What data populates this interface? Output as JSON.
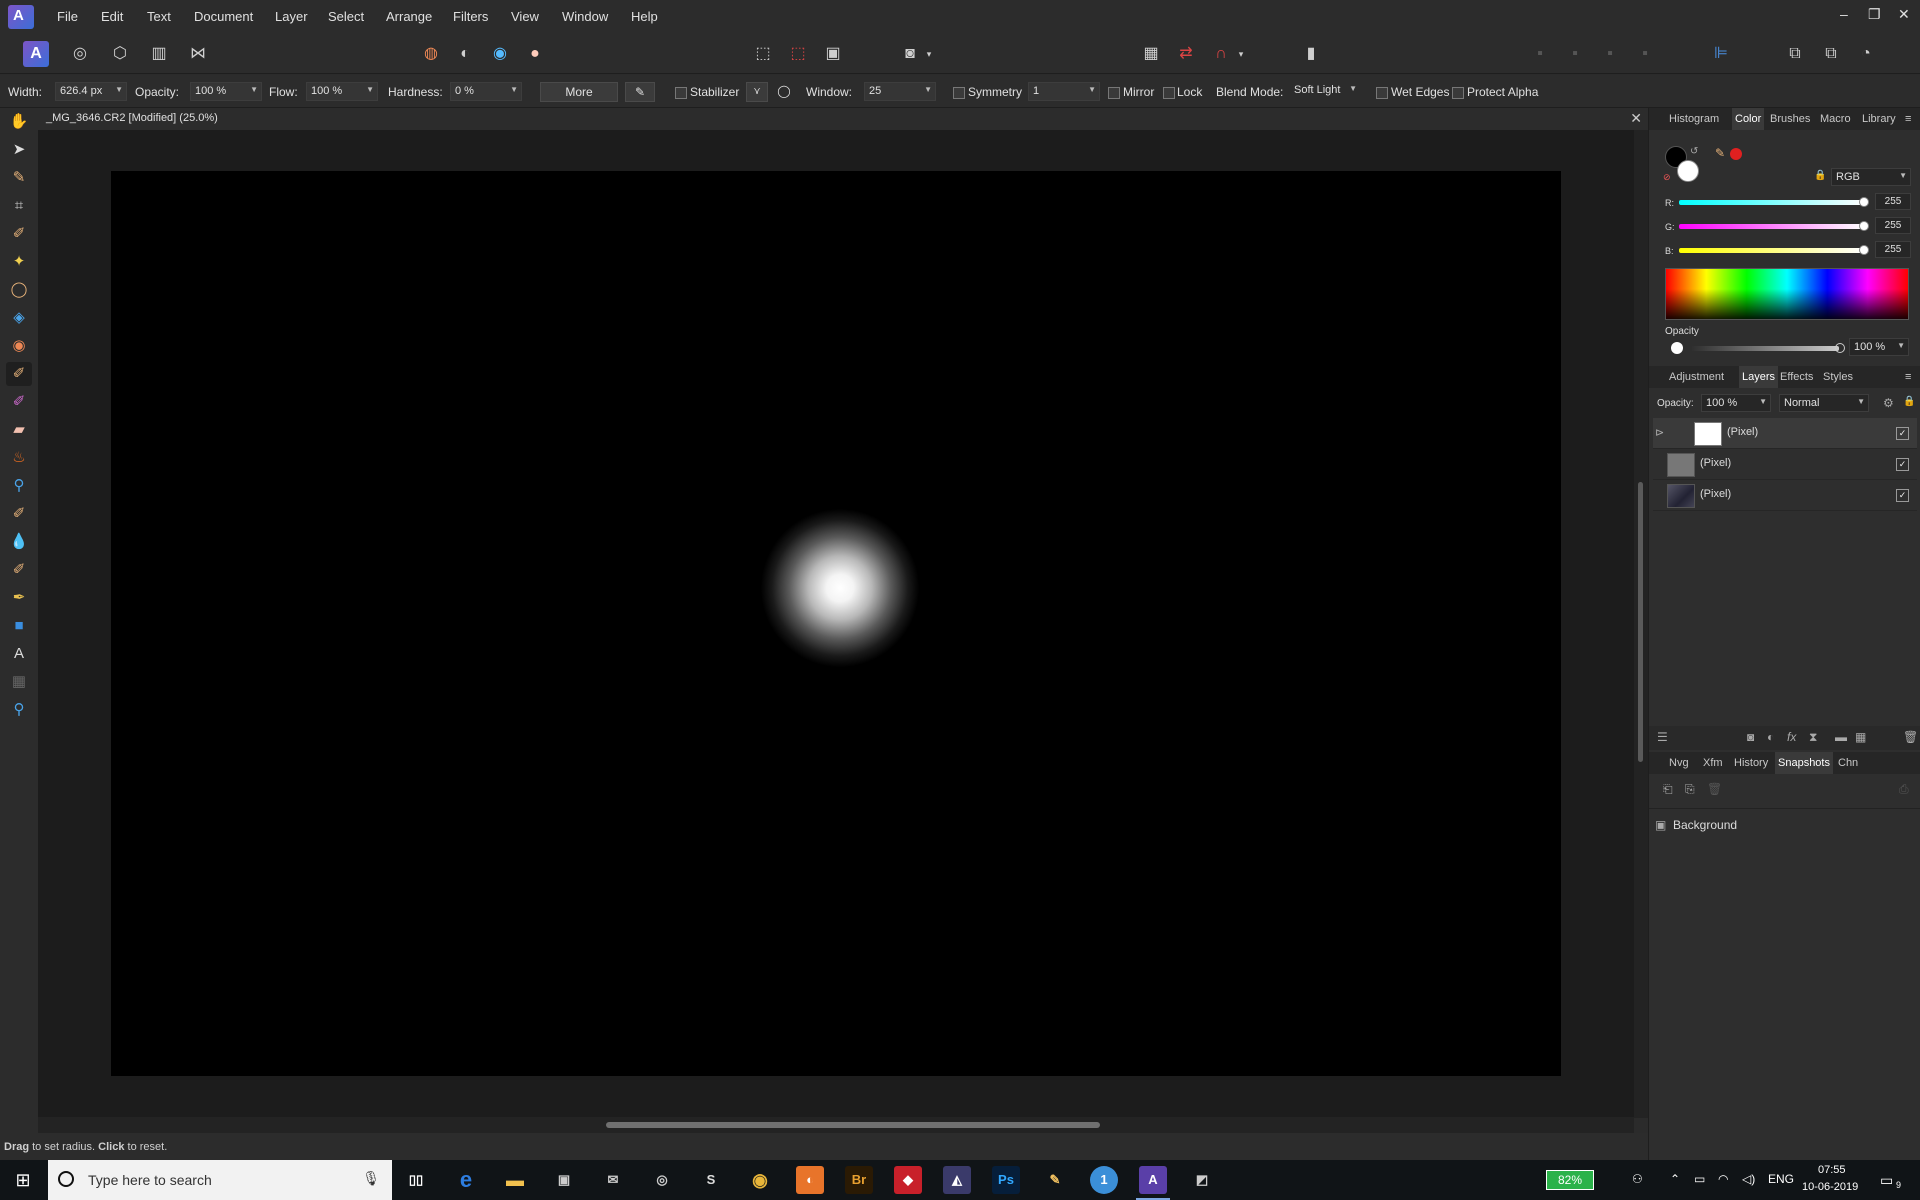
{
  "menubar": {
    "items": [
      "File",
      "Edit",
      "Text",
      "Document",
      "Layer",
      "Select",
      "Arrange",
      "Filters",
      "View",
      "Window",
      "Help"
    ],
    "window_controls": [
      "–",
      "❐",
      "✕"
    ]
  },
  "context": {
    "width_label": "Width:",
    "width_value": "626.4 px",
    "opacity_label": "Opacity:",
    "opacity_value": "100 %",
    "flow_label": "Flow:",
    "flow_value": "100 %",
    "hardness_label": "Hardness:",
    "hardness_value": "0 %",
    "more_label": "More",
    "stabilizer_label": "Stabilizer",
    "window_label": "Window:",
    "window_value": "25",
    "symmetry_label": "Symmetry",
    "symmetry_value": "1",
    "mirror_label": "Mirror",
    "lock_label": "Lock",
    "blend_label": "Blend Mode:",
    "blend_value": "Soft Light",
    "wet_edges_label": "Wet Edges",
    "protect_alpha_label": "Protect Alpha"
  },
  "document": {
    "title": "_MG_3646.CR2 [Modified] (25.0%)"
  },
  "status": {
    "drag": "Drag",
    "drag_text": " to set radius. ",
    "click": "Click",
    "click_text": " to reset."
  },
  "color_panel": {
    "tabs": [
      "Histogram",
      "Color",
      "Brushes",
      "Macro",
      "Library"
    ],
    "selected_tab": "Color",
    "mode": "RGB",
    "r_label": "R:",
    "r_value": "255",
    "g_label": "G:",
    "g_value": "255",
    "b_label": "B:",
    "b_value": "255",
    "opacity_label": "Opacity",
    "opacity_value": "100 %"
  },
  "layers_panel": {
    "tabs": [
      "Adjustment",
      "Layers",
      "Effects",
      "Styles"
    ],
    "selected_tab": "Layers",
    "opacity_label": "Opacity:",
    "opacity_value": "100 %",
    "blend_value": "Normal",
    "layers": [
      {
        "name": "(Pixel)",
        "checked": "✓"
      },
      {
        "name": "(Pixel)",
        "checked": "✓"
      },
      {
        "name": "(Pixel)",
        "checked": "✓"
      }
    ]
  },
  "history_panel": {
    "tabs": [
      "Nvg",
      "Xfm",
      "History",
      "Snapshots",
      "Chn"
    ],
    "selected_tab": "Snapshots",
    "snapshots": [
      "Background"
    ]
  },
  "taskbar": {
    "search_placeholder": "Type here to search",
    "battery": "82%",
    "language": "ENG",
    "time": "07:55",
    "date": "10-06-2019",
    "notifications": "9",
    "app_labels": {
      "bridge": "Br",
      "photoshop": "Ps"
    }
  },
  "colors": {
    "accent": "#7d55c7",
    "battery_green": "#2bb24a"
  }
}
